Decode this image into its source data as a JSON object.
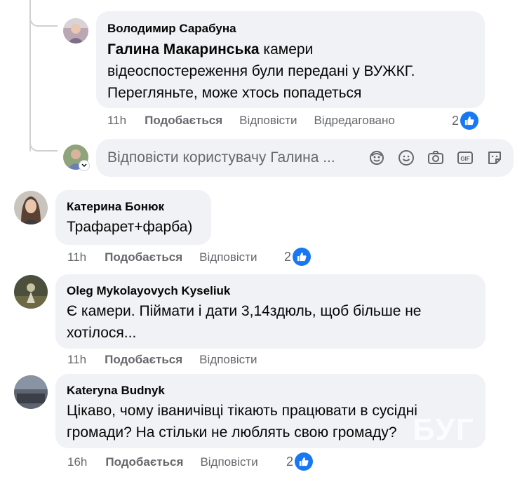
{
  "comments": [
    {
      "author": "Володимир Сарабуна",
      "mention": "Галина Макаринська",
      "text_first": "камери",
      "text_line2": "відеоспостереження були передані у ВУЖКГ.",
      "text_line3": "Перегляньте, може хтось попадеться",
      "time": "11h",
      "like": "Подобається",
      "reply": "Відповісти",
      "edited": "Відредаговано",
      "reactions": "2"
    },
    {
      "author": "Катерина Бонюк",
      "text": "Трафарет+фарба)",
      "time": "11h",
      "like": "Подобається",
      "reply": "Відповісти",
      "reactions": "2"
    },
    {
      "author": "Oleg Mykolayovych Kyseliuk",
      "text_line1": "Є камери. Піймати і дати 3,14здюль, щоб більше не",
      "text_line2": "хотілося...",
      "time": "11h",
      "like": "Подобається",
      "reply": "Відповісти"
    },
    {
      "author": "Kateryna Budnyk",
      "text_line1": "Цікаво, чому іваничівці тікають працювати в сусідні",
      "text_line2": "громади? На стільки не люблять свою громаду?",
      "time": "16h",
      "like": "Подобається",
      "reply": "Відповісти",
      "reactions": "2"
    }
  ],
  "reply_box": {
    "placeholder": "Відповісти користувачу Галина ...",
    "icons": [
      "avatar-sticker-icon",
      "emoji-icon",
      "camera-icon",
      "gif-icon",
      "sticker-icon"
    ]
  },
  "watermark": "БУГ",
  "colors": {
    "bubble": "#f0f2f5",
    "meta": "#65676b",
    "like": "#1877f2",
    "thread": "#ced0d4"
  }
}
